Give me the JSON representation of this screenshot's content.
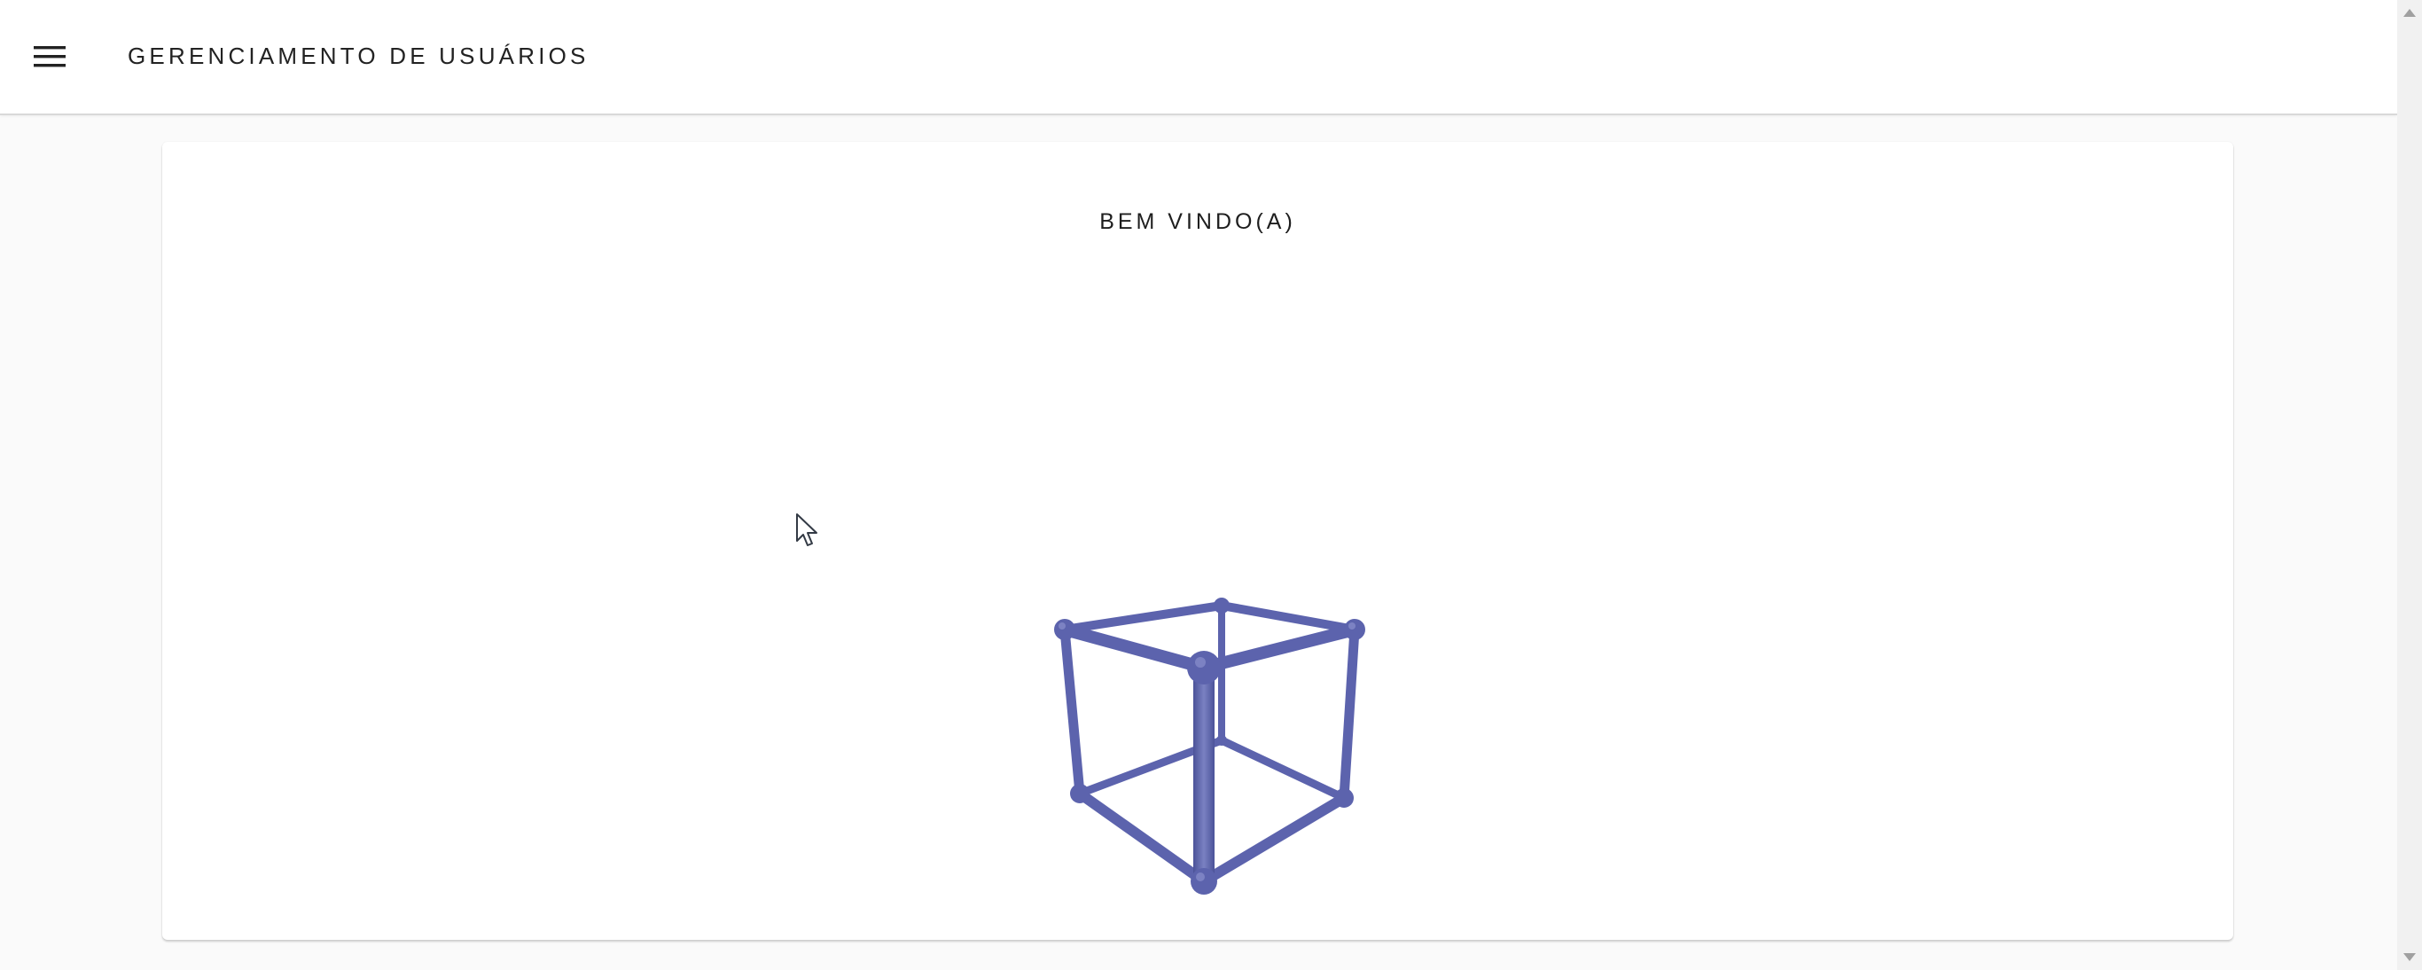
{
  "header": {
    "title": "GERENCIAMENTO DE USUÁRIOS",
    "menu_icon": "hamburger-menu-icon"
  },
  "main": {
    "welcome_text": "BEM VINDO(A)",
    "illustration": "wireframe-cube-icon"
  },
  "colors": {
    "cube": "#5c63ad",
    "cube_highlight": "#7d84c4",
    "text": "#222222",
    "background": "#fafafa",
    "card": "#ffffff"
  }
}
